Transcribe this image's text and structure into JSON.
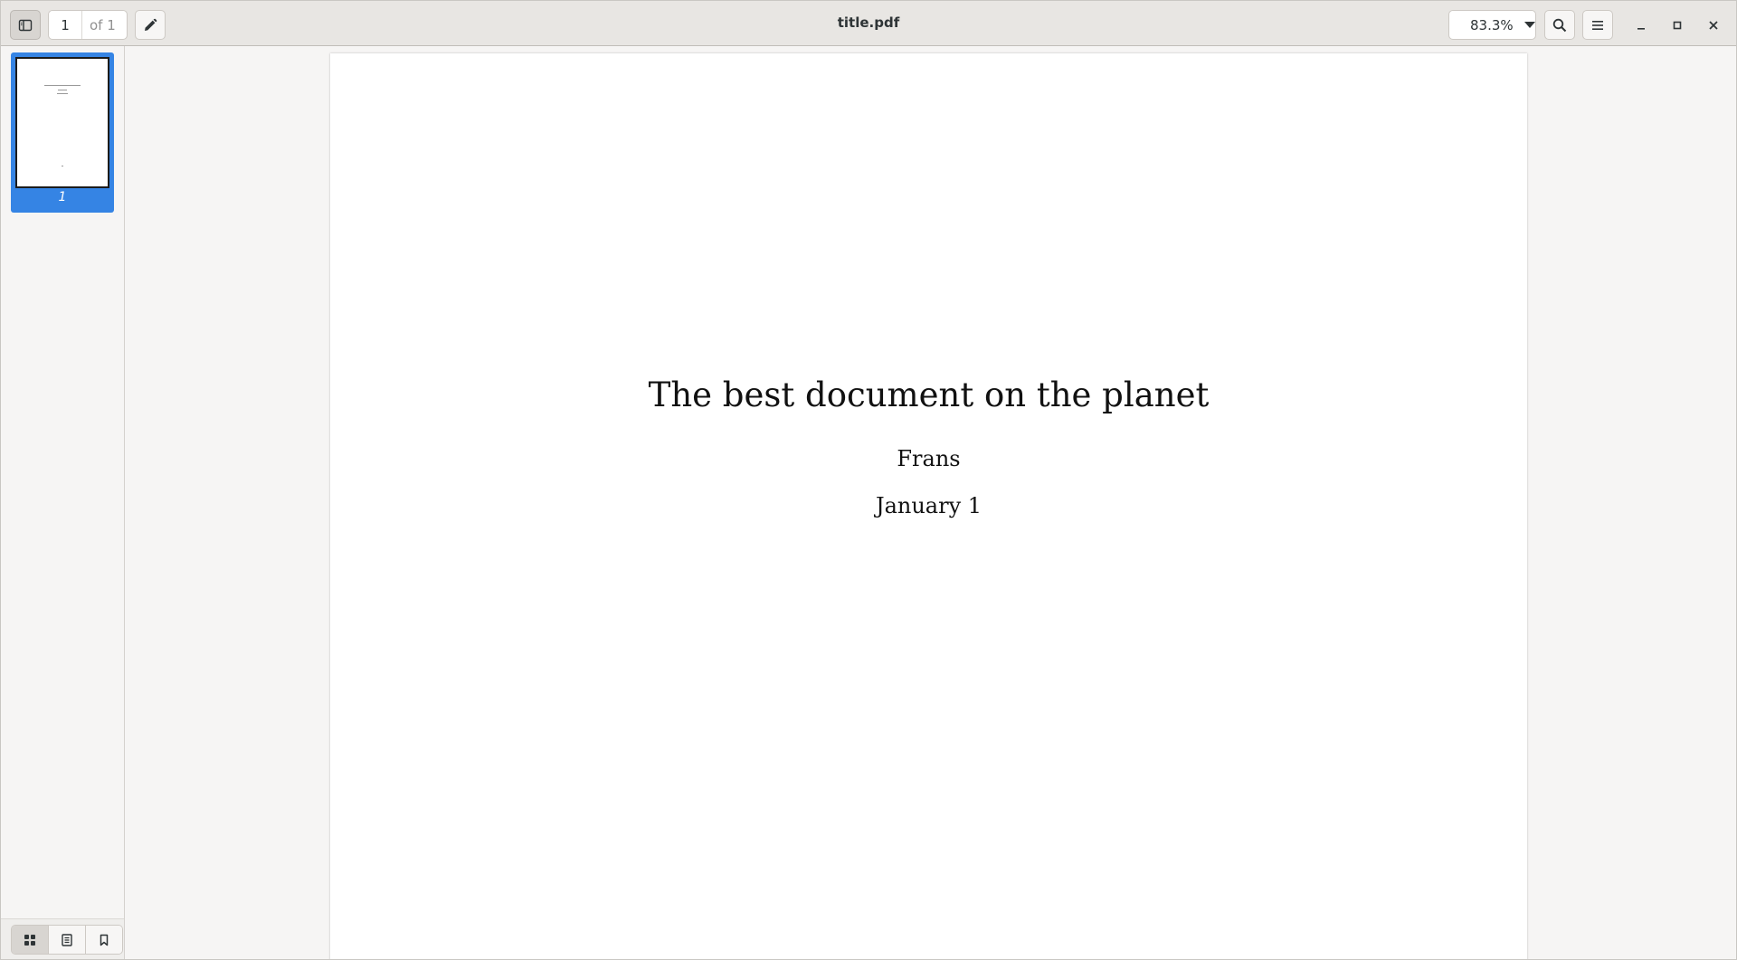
{
  "window": {
    "title": "title.pdf"
  },
  "toolbar": {
    "current_page": "1",
    "total_pages": "of 1",
    "zoom": "83.3%"
  },
  "icons": {
    "sidebar_toggle": "sidebar-toggle-icon",
    "annotate": "pencil-icon",
    "zoom_dropdown": "chevron-down-icon",
    "search": "search-icon",
    "menu": "hamburger-menu-icon",
    "minimize": "minimize-icon",
    "maximize": "maximize-icon",
    "close": "close-icon",
    "thumbnails": "grid-icon",
    "outline": "document-outline-icon",
    "bookmarks": "bookmark-icon"
  },
  "sidebar": {
    "thumbnails": [
      {
        "label": "1",
        "selected": true
      }
    ]
  },
  "document": {
    "title": "The best document on the planet",
    "author": "Frans",
    "date": "January 1"
  },
  "colors": {
    "accent": "#3584e4",
    "headerbar": "#e8e6e3",
    "background": "#f6f5f4"
  }
}
